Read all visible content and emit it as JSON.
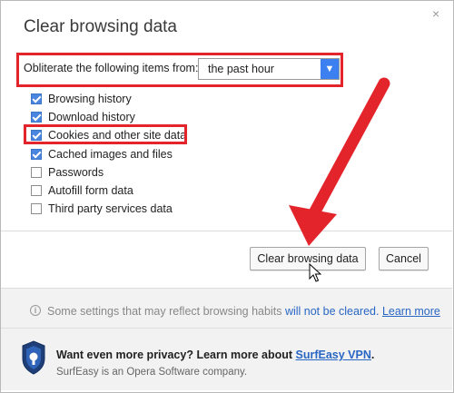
{
  "dialog": {
    "title": "Clear browsing data",
    "close_glyph": "×"
  },
  "obliterate": {
    "label": "Obliterate the following items from:",
    "selected": "the past hour"
  },
  "items": [
    {
      "label": "Browsing history",
      "checked": true
    },
    {
      "label": "Download history",
      "checked": true
    },
    {
      "label": "Cookies and other site data",
      "checked": true
    },
    {
      "label": "Cached images and files",
      "checked": true
    },
    {
      "label": "Passwords",
      "checked": false
    },
    {
      "label": "Autofill form data",
      "checked": false
    },
    {
      "label": "Third party services data",
      "checked": false
    }
  ],
  "buttons": {
    "clear": "Clear browsing data",
    "cancel": "Cancel"
  },
  "info": {
    "prefix": "Some settings that may reflect browsing habits ",
    "highlight": "will not be cleared.",
    "link": "Learn more"
  },
  "promo": {
    "line1_prefix": "Want even more privacy? Learn more about ",
    "line1_link": "SurfEasy VPN",
    "line1_suffix": ".",
    "line2": "SurfEasy is an Opera Software company."
  },
  "colors": {
    "highlight_red": "#e3242b",
    "checkbox_blue": "#4a86e0",
    "link_blue": "#2866c4"
  }
}
